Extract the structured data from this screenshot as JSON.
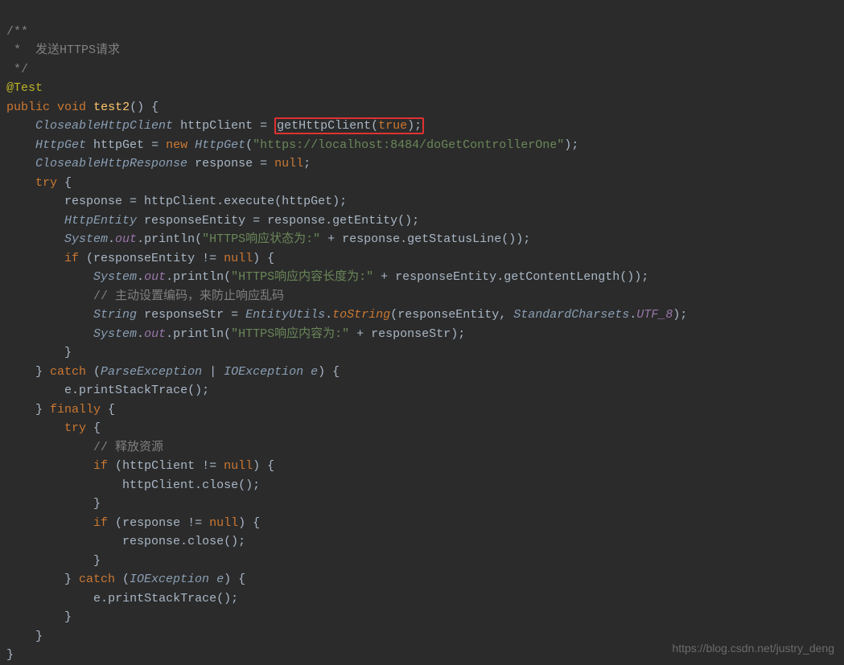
{
  "comments": {
    "block_open": "/**",
    "desc_line": " *  发送HTTPS请求",
    "block_close": " */",
    "inline_encoding": "// 主动设置编码，来防止响应乱码",
    "inline_release": "// 释放资源"
  },
  "annotation": "@Test",
  "keywords": {
    "public": "public",
    "void": "void",
    "new": "new",
    "null": "null",
    "try": "try",
    "if": "if",
    "catch": "catch",
    "finally": "finally",
    "true": "true"
  },
  "types": {
    "CloseableHttpClient": "CloseableHttpClient",
    "HttpGet": "HttpGet",
    "CloseableHttpResponse": "CloseableHttpResponse",
    "HttpEntity": "HttpEntity",
    "System": "System",
    "String": "String",
    "EntityUtils": "EntityUtils",
    "StandardCharsets": "StandardCharsets",
    "ParseException": "ParseException",
    "IOException": "IOException"
  },
  "identifiers": {
    "test2": "test2",
    "httpClient": "httpClient",
    "getHttpClient": "getHttpClient",
    "httpGet": "httpGet",
    "response": "response",
    "execute": "execute",
    "responseEntity": "responseEntity",
    "getEntity": "getEntity",
    "out": "out",
    "println": "println",
    "getStatusLine": "getStatusLine",
    "getContentLength": "getContentLength",
    "responseStr": "responseStr",
    "toString": "toString",
    "UTF_8": "UTF_8",
    "e": "e",
    "printStackTrace": "printStackTrace",
    "close": "close"
  },
  "strings": {
    "url": "\"https://localhost:8484/doGetControllerOne\"",
    "status": "\"HTTPS响应状态为:\"",
    "length": "\"HTTPS响应内容长度为:\"",
    "content": "\"HTTPS响应内容为:\""
  },
  "watermark": "https://blog.csdn.net/justry_deng"
}
